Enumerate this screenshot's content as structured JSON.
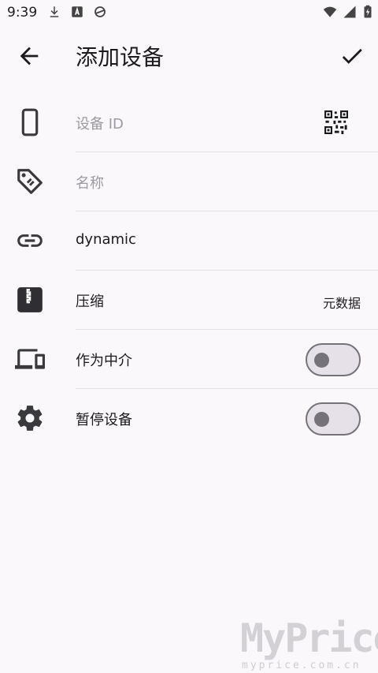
{
  "status_bar": {
    "time": "9:39",
    "icons": [
      "download-icon",
      "a-box-icon",
      "no-sync-icon",
      "wifi-icon",
      "signal-icon",
      "battery-charging-icon"
    ]
  },
  "app_bar": {
    "title": "添加设备",
    "back_icon": "arrow-left-icon",
    "confirm_icon": "check-icon"
  },
  "form": {
    "device_id": {
      "placeholder": "设备 ID",
      "icon": "phone-icon",
      "action_icon": "qr-code-icon"
    },
    "name": {
      "placeholder": "名称",
      "icon": "tag-icon"
    },
    "address": {
      "value": "dynamic",
      "icon": "link-icon"
    },
    "compression": {
      "label": "压缩",
      "value": "元数据",
      "icon": "archive-icon"
    },
    "introducer": {
      "label": "作为中介",
      "checked": false,
      "icon": "devices-icon"
    },
    "paused": {
      "label": "暂停设备",
      "checked": false,
      "icon": "gear-icon"
    }
  },
  "watermark": {
    "brand": "MyPrice",
    "domain": "myprice.com.cn"
  },
  "colors": {
    "background": "#fbf8fb",
    "text": "#1c1b1f",
    "placeholder": "#9e9aa2",
    "divider": "#e7e3e8",
    "switch_off": "#76727a",
    "switch_track": "#e6e0e9"
  }
}
